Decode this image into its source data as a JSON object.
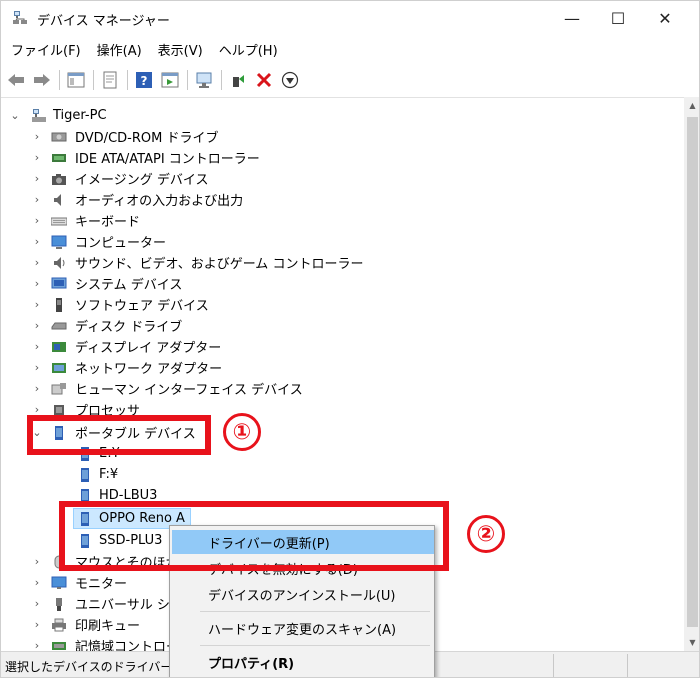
{
  "window": {
    "title": "デバイス マネージャー",
    "min": "—",
    "max": "☐",
    "close": "✕"
  },
  "menu": [
    {
      "label": "ファイル(F)"
    },
    {
      "label": "操作(A)"
    },
    {
      "label": "表示(V)"
    },
    {
      "label": "ヘルプ(H)"
    }
  ],
  "tree": {
    "root": "Tiger-PC",
    "categories": [
      {
        "label": "DVD/CD-ROM ドライブ",
        "icon": "dvd-drive-icon"
      },
      {
        "label": "IDE ATA/ATAPI コントローラー",
        "icon": "ide-controller-icon"
      },
      {
        "label": "イメージング デバイス",
        "icon": "camera-icon"
      },
      {
        "label": "オーディオの入力および出力",
        "icon": "speaker-icon"
      },
      {
        "label": "キーボード",
        "icon": "keyboard-icon"
      },
      {
        "label": "コンピューター",
        "icon": "computer-icon"
      },
      {
        "label": "サウンド、ビデオ、およびゲーム コントローラー",
        "icon": "sound-icon"
      },
      {
        "label": "システム デバイス",
        "icon": "system-device-icon"
      },
      {
        "label": "ソフトウェア デバイス",
        "icon": "software-device-icon"
      },
      {
        "label": "ディスク ドライブ",
        "icon": "disk-drive-icon"
      },
      {
        "label": "ディスプレイ アダプター",
        "icon": "display-adapter-icon"
      },
      {
        "label": "ネットワーク アダプター",
        "icon": "network-adapter-icon"
      },
      {
        "label": "ヒューマン インターフェイス デバイス",
        "icon": "hid-icon"
      },
      {
        "label": "プロセッサ",
        "icon": "processor-icon"
      }
    ],
    "portable": {
      "label": "ポータブル デバイス",
      "children": [
        "E:¥",
        "F:¥",
        "HD-LBU3",
        "OPPO Reno A",
        "SSD-PLU3"
      ]
    },
    "after": [
      {
        "label": "マウスとそのほかのポインティング デバイス",
        "icon": "mouse-icon"
      },
      {
        "label": "モニター",
        "icon": "monitor-icon"
      },
      {
        "label": "ユニバーサル シリアル バス コントローラー",
        "icon": "usb-icon"
      },
      {
        "label": "印刷キュー",
        "icon": "printer-icon"
      },
      {
        "label": "記憶域コントローラー",
        "icon": "storage-icon"
      }
    ]
  },
  "context_menu": {
    "update": "ドライバーの更新(P)",
    "disable": "デバイスを無効にする(D)",
    "uninstall": "デバイスのアンインストール(U)",
    "scan": "ハードウェア変更のスキャン(A)",
    "properties": "プロパティ(R)"
  },
  "status": {
    "text": "選択したデバイスのドライバー更新"
  },
  "annotations": {
    "one": "①",
    "two": "②"
  },
  "colors": {
    "annotation_red": "#e8121b",
    "selection": "#cce8ff",
    "menu_highlight": "#91c9f7"
  }
}
